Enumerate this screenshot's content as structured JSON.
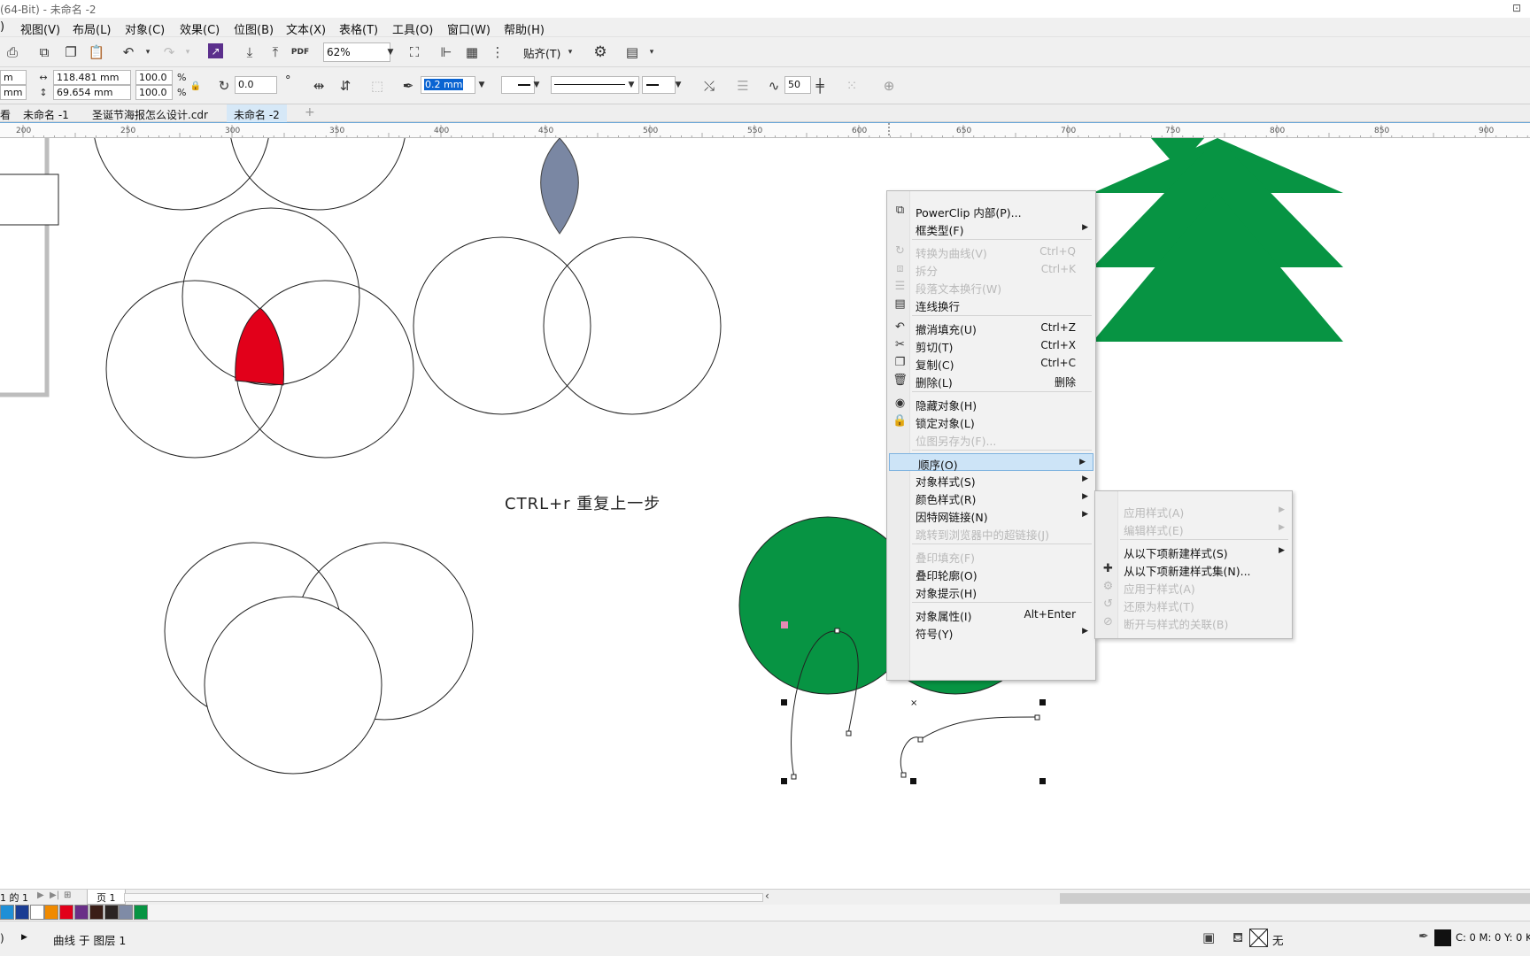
{
  "window": {
    "title": "(64-Bit) - 未命名 -2",
    "close_glyph": "⊡"
  },
  "menubar": [
    "视图(V)",
    "布局(L)",
    "对象(C)",
    "效果(C)",
    "位图(B)",
    "文本(X)",
    "表格(T)",
    "工具(O)",
    "窗口(W)",
    "帮助(H)"
  ],
  "toolbar": {
    "zoom": "62%",
    "snap_label": "贴齐(T)"
  },
  "property_bar": {
    "pos_x_unit": "m",
    "pos_y_unit": "mm",
    "width": "118.481 mm",
    "height": "69.654 mm",
    "scale_x": "100.0",
    "scale_y": "100.0",
    "pct1": "%",
    "pct2": "%",
    "rotation": "0.0",
    "degree": "°",
    "outline_width": "0.2 mm",
    "smoothing": "50"
  },
  "tabs": [
    "未命名 -1",
    "圣诞节海报怎么设计.cdr",
    "未命名 -2"
  ],
  "tab_leading": "看",
  "ruler_ticks": [
    "200",
    "250",
    "300",
    "350",
    "400",
    "450",
    "500",
    "550",
    "600",
    "650",
    "700",
    "750",
    "800",
    "850",
    "900"
  ],
  "canvas": {
    "hint_text": "CTRL+r 重复上一步",
    "colors": {
      "green": "#079443",
      "red": "#e2001a",
      "slate": "#7a87a3"
    }
  },
  "context_menu": {
    "items": [
      {
        "label": "PowerClip 内部(P)...",
        "icon": "powerclip-icon"
      },
      {
        "label": "框类型(F)",
        "submenu": true
      },
      {
        "label": "转换为曲线(V)",
        "shortcut": "Ctrl+Q",
        "disabled": true,
        "icon": "convert-curve-icon"
      },
      {
        "label": "拆分",
        "shortcut": "Ctrl+K",
        "disabled": true,
        "icon": "break-apart-icon"
      },
      {
        "label": "段落文本换行(W)",
        "disabled": true,
        "icon": "wrap-text-icon"
      },
      {
        "label": "连线换行",
        "icon": "connector-wrap-icon"
      },
      {
        "label": "撤消填充(U)",
        "shortcut": "Ctrl+Z",
        "icon": "undo-icon"
      },
      {
        "label": "剪切(T)",
        "shortcut": "Ctrl+X",
        "icon": "cut-icon"
      },
      {
        "label": "复制(C)",
        "shortcut": "Ctrl+C",
        "icon": "copy-icon"
      },
      {
        "label": "删除(L)",
        "shortcut": "删除",
        "icon": "trash-icon"
      },
      {
        "label": "隐藏对象(H)",
        "icon": "hide-icon"
      },
      {
        "label": "锁定对象(L)",
        "icon": "lock-icon"
      },
      {
        "label": "位图另存为(F)...",
        "disabled": true
      },
      {
        "label": "顺序(O)",
        "submenu": true,
        "highlighted": true
      },
      {
        "label": "对象样式(S)",
        "submenu": true
      },
      {
        "label": "颜色样式(R)",
        "submenu": true
      },
      {
        "label": "因特网链接(N)",
        "submenu": true
      },
      {
        "label": "跳转到浏览器中的超链接(J)",
        "disabled": true
      },
      {
        "label": "叠印填充(F)",
        "disabled": true
      },
      {
        "label": "叠印轮廓(O)"
      },
      {
        "label": "对象提示(H)"
      },
      {
        "label": "对象属性(I)",
        "shortcut": "Alt+Enter"
      },
      {
        "label": "符号(Y)",
        "submenu": true
      }
    ]
  },
  "sub_menu": {
    "items": [
      {
        "label": "应用样式(A)",
        "submenu": true,
        "disabled": true
      },
      {
        "label": "编辑样式(E)",
        "submenu": true,
        "disabled": true
      },
      {
        "label": "从以下项新建样式(S)",
        "submenu": true
      },
      {
        "label": "从以下项新建样式集(N)...",
        "icon": "new-style-set-icon"
      },
      {
        "label": "应用于样式(A)",
        "disabled": true,
        "icon": "apply-style-icon"
      },
      {
        "label": "还原为样式(T)",
        "disabled": true,
        "icon": "revert-style-icon"
      },
      {
        "label": "断开与样式的关联(B)",
        "disabled": true,
        "icon": "break-style-icon"
      }
    ]
  },
  "page_nav": {
    "counter": "1 的 1",
    "page_tab": "页 1"
  },
  "palette": [
    "#1f8fd6",
    "#1b3d93",
    "#ffffff",
    "#f08a00",
    "#e2001a",
    "#6a2f87",
    "#3a1e17",
    "#2b2422",
    "#7f8ba6",
    "#079443"
  ],
  "status": {
    "left_glyph": ")",
    "layer_text": "曲线 于 图层 1",
    "fill_none": "无",
    "cmyk": "C: 0 M: 0 Y: 0 K:"
  }
}
